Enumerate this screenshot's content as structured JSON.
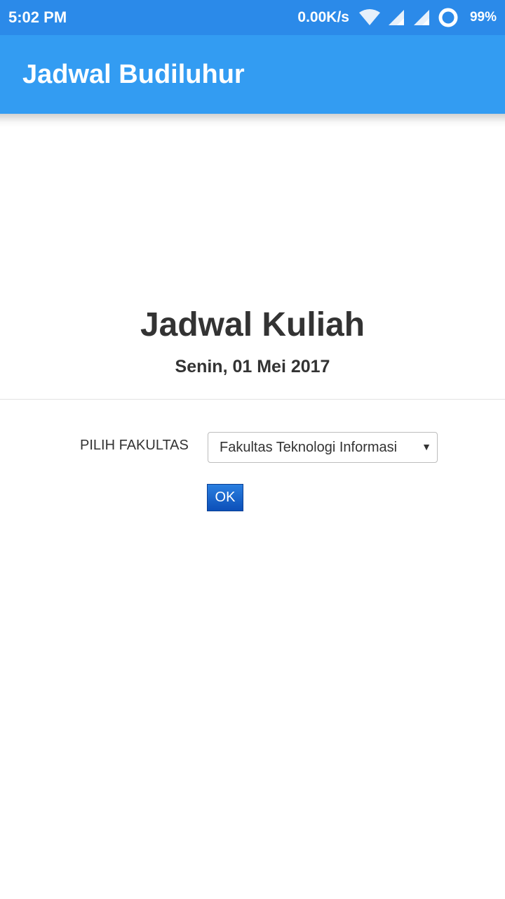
{
  "status_bar": {
    "time": "5:02 PM",
    "network_speed": "0.00K/s",
    "battery": "99%",
    "icons": [
      "wifi-icon",
      "signal-icon",
      "signal-icon",
      "sync-ring-icon"
    ]
  },
  "app_bar": {
    "title": "Jadwal Budiluhur",
    "color": "#339cf2"
  },
  "main": {
    "heading": "Jadwal Kuliah",
    "date": "Senin, 01 Mei 2017",
    "form": {
      "label": "PILIH FAKULTAS",
      "selected_option": "Fakultas Teknologi Informasi",
      "submit_label": "OK"
    }
  },
  "colors": {
    "status_bar": "#2b8ae9",
    "button": "#0c4fb8"
  }
}
